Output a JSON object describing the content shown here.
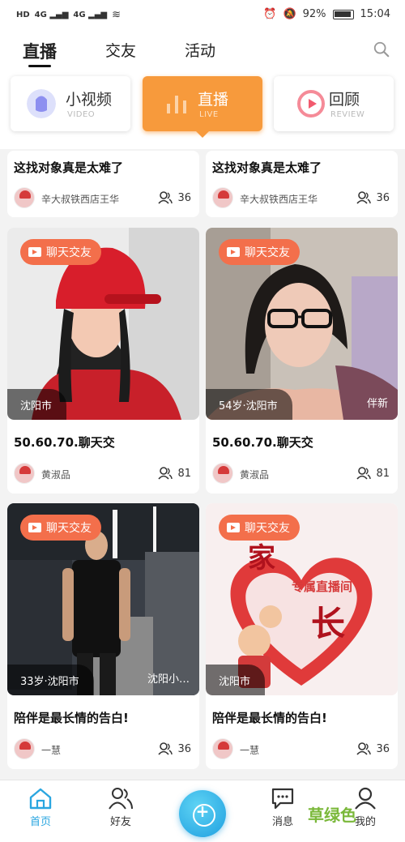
{
  "status_bar": {
    "left_signal": "HD",
    "battery": "92%",
    "time": "15:04"
  },
  "header": {
    "tabs": [
      {
        "label": "直播",
        "active": true
      },
      {
        "label": "交友",
        "active": false
      },
      {
        "label": "活动",
        "active": false
      }
    ],
    "search_icon": "search-icon"
  },
  "categories": [
    {
      "title": "小视频",
      "subtitle": "VIDEO",
      "icon": "video-icon",
      "active": false
    },
    {
      "title": "直播",
      "subtitle": "LIVE",
      "icon": "bars-icon",
      "active": true
    },
    {
      "title": "回顾",
      "subtitle": "REVIEW",
      "icon": "replay-icon",
      "active": false
    }
  ],
  "feed": [
    {
      "title": "这找对象真是太难了",
      "user": "辛大叔铁西店王华",
      "viewers": "36"
    },
    {
      "title": "这找对象真是太难了",
      "user": "辛大叔铁西店王华",
      "viewers": "36"
    },
    {
      "badge": "聊天交友",
      "location": "沈阳市",
      "title": "50.60.70.聊天交",
      "user": "黄淑品",
      "viewers": "81"
    },
    {
      "badge": "聊天交友",
      "location": "54岁·沈阳市",
      "corner": "伴新",
      "title": "50.60.70.聊天交",
      "user": "黄淑品",
      "viewers": "81"
    },
    {
      "badge": "聊天交友",
      "location": "33岁·沈阳市",
      "corner": "沈阳小…",
      "title": "陪伴是最长情的告白!",
      "user": "一慧",
      "viewers": "36"
    },
    {
      "badge": "聊天交友",
      "location": "沈阳市",
      "title": "陪伴是最长情的告白!",
      "user": "一慧",
      "viewers": "36",
      "poster_text_1": "家",
      "poster_text_2": "专属直播间",
      "poster_text_3": "长"
    }
  ],
  "bottom_nav": [
    {
      "label": "首页",
      "icon": "home-icon",
      "active": true
    },
    {
      "label": "好友",
      "icon": "friends-icon",
      "active": false
    },
    {
      "label": "消息",
      "icon": "message-icon",
      "active": false
    },
    {
      "label": "我的",
      "icon": "profile-icon",
      "active": false
    }
  ],
  "watermark": "草绿色",
  "colors": {
    "accent_orange": "#f79a3c",
    "badge_orange": "#f36f4b",
    "nav_active": "#2aa6e0"
  }
}
